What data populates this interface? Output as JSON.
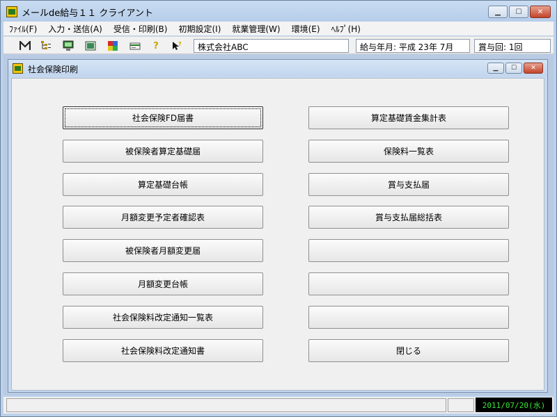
{
  "window": {
    "title": "メールde給与１１ クライアント"
  },
  "menu": [
    {
      "label": "ﾌｧｲﾙ(F)"
    },
    {
      "label": "入力・送信(A)"
    },
    {
      "label": "受信・印刷(B)"
    },
    {
      "label": "初期設定(I)"
    },
    {
      "label": "就業管理(W)"
    },
    {
      "label": "環境(E)"
    },
    {
      "label": "ﾍﾙﾌﾟ(H)"
    }
  ],
  "toolbar": {
    "icons": [
      "mail-icon",
      "tree-icon",
      "monitor-icon",
      "window-icon",
      "grid-icon",
      "card-icon",
      "help-icon",
      "cursor-help-icon"
    ],
    "company": "株式会社ABC",
    "pay_period": "給与年月: 平成 23年  7月",
    "bonus_count": "賞与回: 1回"
  },
  "child_window": {
    "title": "社会保険印刷"
  },
  "buttons_left": [
    "社会保険FD届書",
    "被保険者算定基礎届",
    "算定基礎台帳",
    "月額変更予定者確認表",
    "被保険者月額変更届",
    "月額変更台帳",
    "社会保険料改定通知一覧表",
    "社会保険料改定通知書"
  ],
  "buttons_right": [
    "算定基礎賃金集計表",
    "保険料一覧表",
    "賞与支払届",
    "賞与支払届総括表",
    "",
    "",
    "",
    "閉じる"
  ],
  "statusbar": {
    "date": "2011/07/20(水)"
  },
  "colors": {
    "frame": "#bcd2ec",
    "date_fg": "#39e639"
  }
}
